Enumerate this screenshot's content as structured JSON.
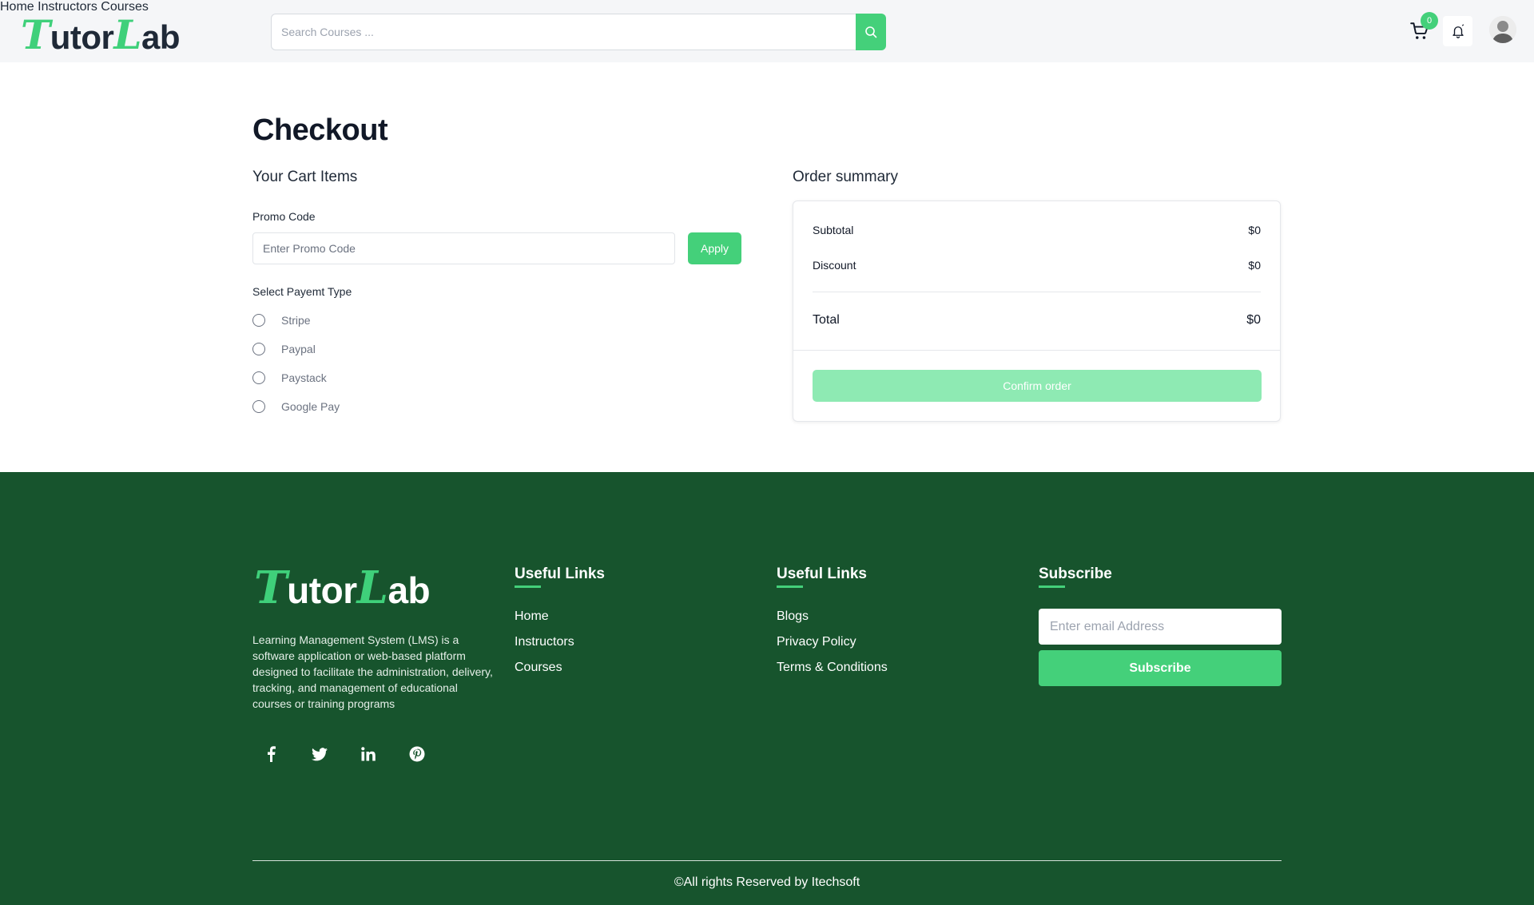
{
  "header": {
    "logo": {
      "first_letter": "T",
      "part1": "utor",
      "second_letter": "L",
      "part2": "ab"
    },
    "search": {
      "placeholder": "Search Courses ..."
    },
    "nav": [
      "Home",
      "Instructors",
      "Courses"
    ],
    "cart_count": "0"
  },
  "checkout": {
    "title": "Checkout",
    "cart_section_title": "Your Cart Items",
    "promo_label": "Promo Code",
    "promo_placeholder": "Enter Promo Code",
    "apply_label": "Apply",
    "payment_label": "Select Payemt Type",
    "payment_options": [
      "Stripe",
      "Paypal",
      "Paystack",
      "Google Pay"
    ]
  },
  "summary": {
    "title": "Order summary",
    "subtotal_label": "Subtotal",
    "subtotal_value": "$0",
    "discount_label": "Discount",
    "discount_value": "$0",
    "total_label": "Total",
    "total_value": "$0",
    "confirm_label": "Confirm order"
  },
  "footer": {
    "logo": {
      "first_letter": "T",
      "part1": "utor",
      "second_letter": "L",
      "part2": "ab"
    },
    "description": "Learning Management System (LMS) is a software application or web-based platform designed to facilitate the administration, delivery, tracking, and management of educational courses or training programs",
    "social_icons": [
      "facebook-icon",
      "twitter-icon",
      "linkedin-icon",
      "pinterest-icon"
    ],
    "useful_links_1": {
      "title": "Useful Links",
      "links": [
        "Home",
        "Instructors",
        "Courses"
      ]
    },
    "useful_links_2": {
      "title": "Useful Links",
      "links": [
        "Blogs",
        "Privacy Policy",
        "Terms & Conditions"
      ]
    },
    "subscribe": {
      "title": "Subscribe",
      "placeholder": "Enter email Address",
      "button_label": "Subscribe"
    },
    "copyright": "©All rights Reserved by Itechsoft"
  },
  "colors": {
    "brand_green": "#44d07a",
    "footer_bg": "#17542d",
    "header_bg": "#f5f6f8",
    "confirm_disabled": "#8eeab3"
  }
}
